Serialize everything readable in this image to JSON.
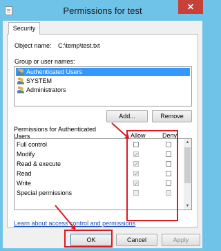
{
  "window": {
    "title": "Permissions for test",
    "close_label": "✕"
  },
  "tabs": [
    {
      "label": "Security"
    }
  ],
  "object": {
    "label": "Object name:",
    "value": "C:\\temp\\test.txt"
  },
  "groups": {
    "label": "Group or user names:",
    "items": [
      {
        "label": "Authenticated Users",
        "selected": true
      },
      {
        "label": "SYSTEM",
        "selected": false
      },
      {
        "label": "Administrators",
        "selected": false
      }
    ],
    "add_label": "Add...",
    "remove_label": "Remove"
  },
  "permissions": {
    "header_line1": "Permissions for Authenticated",
    "header_line2": "Users",
    "allow_label": "Allow",
    "deny_label": "Deny",
    "rows": [
      {
        "name": "Full control",
        "allow": false,
        "deny": false,
        "disabled": false
      },
      {
        "name": "Modify",
        "allow": true,
        "deny": false,
        "disabled": true
      },
      {
        "name": "Read & execute",
        "allow": true,
        "deny": false,
        "disabled": true
      },
      {
        "name": "Read",
        "allow": true,
        "deny": false,
        "disabled": true
      },
      {
        "name": "Write",
        "allow": true,
        "deny": false,
        "disabled": true
      },
      {
        "name": "Special permissions",
        "allow": false,
        "deny": false,
        "disabled": true
      }
    ]
  },
  "link": "Learn about access control and permissions",
  "buttons": {
    "ok": "OK",
    "cancel": "Cancel",
    "apply": "Apply"
  },
  "annotation_color": "#e0181f"
}
